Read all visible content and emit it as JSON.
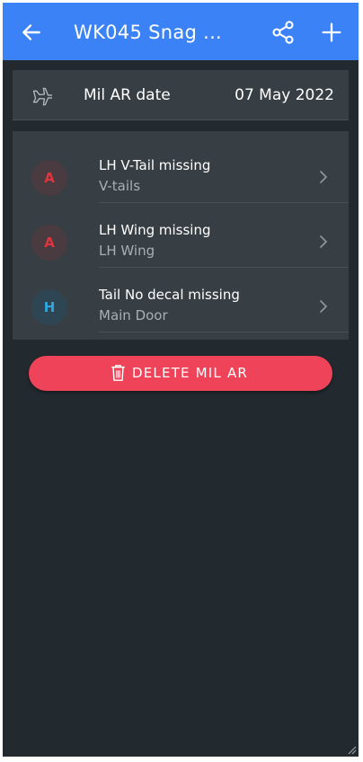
{
  "header": {
    "title": "WK045 Snag ...",
    "back_icon": "arrow-left-icon",
    "share_icon": "share-icon",
    "add_icon": "plus-icon",
    "background_color": "#3b82f6"
  },
  "date_row": {
    "icon": "airplane-icon",
    "label": "Mil AR date",
    "value": "07 May 2022"
  },
  "snags": [
    {
      "badge": "A",
      "title": "LH V-Tail missing",
      "subtitle": "V-tails",
      "badge_color": "#e0343f"
    },
    {
      "badge": "A",
      "title": "LH Wing missing",
      "subtitle": "LH Wing",
      "badge_color": "#e0343f"
    },
    {
      "badge": "H",
      "title": "Tail No decal missing",
      "subtitle": "Main Door",
      "badge_color": "#2fa6e0"
    }
  ],
  "delete_button": {
    "label": "DELETE MIL AR",
    "icon": "trash-icon",
    "color": "#ee4358"
  },
  "theme": {
    "background": "#232a2f",
    "card": "#383f44"
  }
}
